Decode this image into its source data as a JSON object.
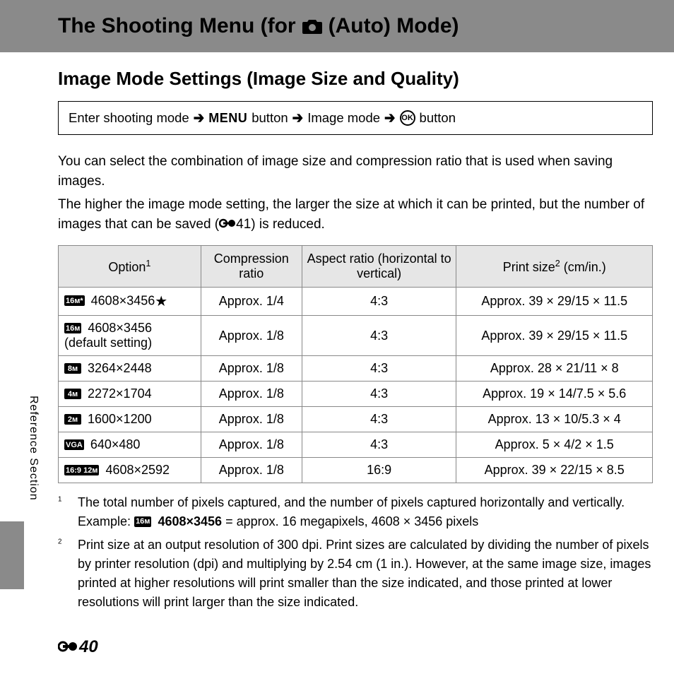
{
  "header": {
    "title_left": "The Shooting Menu (for",
    "title_right": "(Auto) Mode)"
  },
  "subtitle": "Image Mode Settings (Image Size and Quality)",
  "breadcrumb": {
    "step1": "Enter shooting mode",
    "menu_label": "MENU",
    "step2_suffix": "button",
    "step3": "Image mode",
    "ok_label": "OK",
    "step4_suffix": "button"
  },
  "intro": {
    "p1": "You can select the combination of image size and compression ratio that is used when saving images.",
    "p2_a": "The higher the image mode setting, the larger the size at which it can be printed, but the number of images that can be saved (",
    "p2_ref": "41",
    "p2_b": ") is reduced."
  },
  "table": {
    "headers": {
      "option": "Option",
      "compression": "Compression ratio",
      "aspect": "Aspect ratio (horizontal to vertical)",
      "print": "Print size",
      "print_suffix": " (cm/in.)"
    },
    "rows": [
      {
        "badge": "16ᴍ*",
        "label": "4608×3456",
        "star": true,
        "note": "",
        "compression": "Approx. 1/4",
        "aspect": "4:3",
        "print": "Approx. 39 × 29/15 × 11.5"
      },
      {
        "badge": "16ᴍ",
        "label": "4608×3456",
        "star": false,
        "note": "(default setting)",
        "compression": "Approx. 1/8",
        "aspect": "4:3",
        "print": "Approx. 39 × 29/15 × 11.5"
      },
      {
        "badge": "8ᴍ",
        "label": "3264×2448",
        "star": false,
        "note": "",
        "compression": "Approx. 1/8",
        "aspect": "4:3",
        "print": "Approx. 28 × 21/11 × 8"
      },
      {
        "badge": "4ᴍ",
        "label": "2272×1704",
        "star": false,
        "note": "",
        "compression": "Approx. 1/8",
        "aspect": "4:3",
        "print": "Approx. 19 × 14/7.5 × 5.6"
      },
      {
        "badge": "2ᴍ",
        "label": "1600×1200",
        "star": false,
        "note": "",
        "compression": "Approx. 1/8",
        "aspect": "4:3",
        "print": "Approx. 13 × 10/5.3 × 4"
      },
      {
        "badge": "VGA",
        "label": "640×480",
        "star": false,
        "note": "",
        "compression": "Approx. 1/8",
        "aspect": "4:3",
        "print": "Approx. 5 × 4/2 × 1.5"
      },
      {
        "badge": "16:9 12ᴍ",
        "label": "4608×2592",
        "star": false,
        "note": "",
        "compression": "Approx. 1/8",
        "aspect": "16:9",
        "print": "Approx. 39 × 22/15 × 8.5"
      }
    ]
  },
  "footnotes": {
    "f1_a": "The total number of pixels captured, and the number of pixels captured horizontally and vertically.",
    "f1_example_prefix": "Example:",
    "f1_example_badge": "16ᴍ",
    "f1_example_bold": "4608×3456",
    "f1_example_suffix": " = approx. 16 megapixels, 4608 × 3456 pixels",
    "f2": "Print size at an output resolution of 300 dpi. Print sizes are calculated by dividing the number of pixels by printer resolution (dpi) and multiplying by 2.54 cm (1 in.). However, at the same image size, images printed at higher resolutions will print smaller than the size indicated, and those printed at lower resolutions will print larger than the size indicated."
  },
  "side_label": "Reference Section",
  "page_number": "40"
}
